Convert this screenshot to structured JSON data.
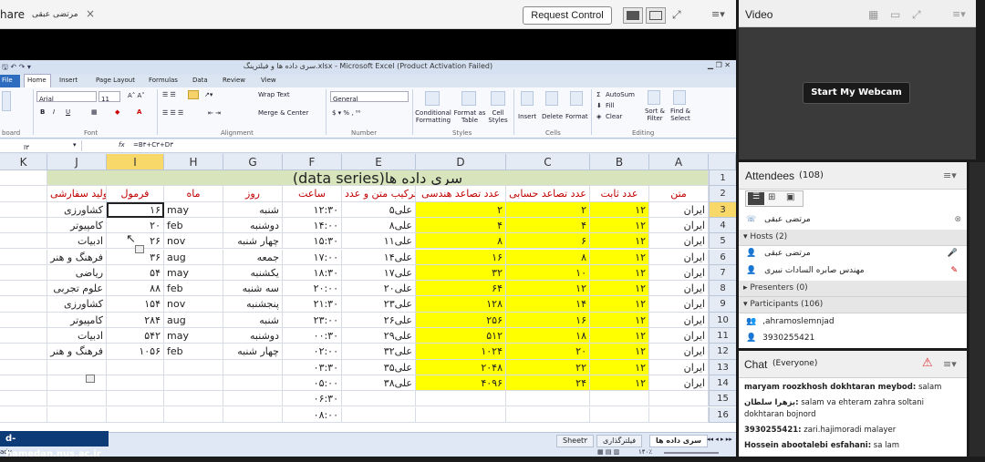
{
  "share": {
    "title": "hare",
    "presenter": "مرتضی عبقی",
    "close": "×",
    "request_control": "Request Control"
  },
  "excel": {
    "window_title": "سری داده ها و فیلترینگ.xlsx - Microsoft Excel (Product Activation Failed)",
    "ribbon_tabs": [
      "File",
      "Home",
      "Insert",
      "Page Layout",
      "Formulas",
      "Data",
      "Review",
      "View"
    ],
    "font_name": "Arial",
    "font_size": "11",
    "number_format": "General",
    "buttons": {
      "wrap_text": "Wrap Text",
      "merge_center": "Merge & Center",
      "cond_format": "Conditional Formatting",
      "format_table": "Format as Table",
      "cell_styles": "Cell Styles",
      "insert": "Insert",
      "delete": "Delete",
      "format": "Format",
      "autosum": "AutoSum",
      "fill": "Fill",
      "clear": "Clear",
      "sort_filter": "Sort & Filter",
      "find_select": "Find & Select"
    },
    "groups": [
      "board",
      "Font",
      "Alignment",
      "Number",
      "Styles",
      "Cells",
      "Editing"
    ],
    "name_box": "I۳",
    "formula": "=B۳+C۳+D۳",
    "fx": "fx",
    "columns": [
      "K",
      "J",
      "I",
      "H",
      "G",
      "F",
      "E",
      "D",
      "C",
      "B",
      "A"
    ],
    "row_numbers": [
      "1",
      "2",
      "3",
      "4",
      "5",
      "6",
      "7",
      "8",
      "9",
      "10",
      "11",
      "12",
      "13",
      "14",
      "15",
      "16"
    ],
    "sheet_title": "سری داده ها(data series)",
    "headers": {
      "A": "متن",
      "B": "عدد ثابت",
      "C": "عدد تصاعد حسابی",
      "D": "عدد تصاعد هندسی",
      "E": "ترکیب متن و عدد",
      "F": "ساعت",
      "G": "روز",
      "H": "ماه",
      "I": "فرمول",
      "J": "تولید سفارشی"
    },
    "rows": [
      {
        "A": "ایران",
        "B": "۱۲",
        "C": "۲",
        "D": "۲",
        "E": "علی۵",
        "F": "۱۲:۳۰",
        "G": "شنبه",
        "H": "may",
        "I": "۱۶",
        "J": "کشاورزی"
      },
      {
        "A": "ایران",
        "B": "۱۲",
        "C": "۴",
        "D": "۴",
        "E": "علی۸",
        "F": "۱۴:۰۰",
        "G": "دوشنبه",
        "H": "feb",
        "I": "۲۰",
        "J": "کامپیوتر"
      },
      {
        "A": "ایران",
        "B": "۱۲",
        "C": "۶",
        "D": "۸",
        "E": "علی۱۱",
        "F": "۱۵:۳۰",
        "G": "چهار شنبه",
        "H": "nov",
        "I": "۲۶",
        "J": "ادبیات"
      },
      {
        "A": "ایران",
        "B": "۱۲",
        "C": "۸",
        "D": "۱۶",
        "E": "علی۱۴",
        "F": "۱۷:۰۰",
        "G": "جمعه",
        "H": "aug",
        "I": "۳۶",
        "J": "فرهنگ و هنر"
      },
      {
        "A": "ایران",
        "B": "۱۲",
        "C": "۱۰",
        "D": "۳۲",
        "E": "علی۱۷",
        "F": "۱۸:۳۰",
        "G": "یکشنبه",
        "H": "may",
        "I": "۵۴",
        "J": "ریاضی"
      },
      {
        "A": "ایران",
        "B": "۱۲",
        "C": "۱۲",
        "D": "۶۴",
        "E": "علی۲۰",
        "F": "۲۰:۰۰",
        "G": "سه شنبه",
        "H": "feb",
        "I": "۸۸",
        "J": "علوم تجربی"
      },
      {
        "A": "ایران",
        "B": "۱۲",
        "C": "۱۴",
        "D": "۱۲۸",
        "E": "علی۲۳",
        "F": "۲۱:۳۰",
        "G": "پنجشنبه",
        "H": "nov",
        "I": "۱۵۴",
        "J": "کشاورزی"
      },
      {
        "A": "ایران",
        "B": "۱۲",
        "C": "۱۶",
        "D": "۲۵۶",
        "E": "علی۲۶",
        "F": "۲۳:۰۰",
        "G": "شنبه",
        "H": "aug",
        "I": "۲۸۴",
        "J": "کامپیوتر"
      },
      {
        "A": "ایران",
        "B": "۱۲",
        "C": "۱۸",
        "D": "۵۱۲",
        "E": "علی۲۹",
        "F": "۰۰:۳۰",
        "G": "دوشنبه",
        "H": "may",
        "I": "۵۴۲",
        "J": "ادبیات"
      },
      {
        "A": "ایران",
        "B": "۱۲",
        "C": "۲۰",
        "D": "۱۰۲۴",
        "E": "علی۳۲",
        "F": "۰۲:۰۰",
        "G": "چهار شنبه",
        "H": "feb",
        "I": "۱۰۵۶",
        "J": "فرهنگ و هنر"
      },
      {
        "A": "ایران",
        "B": "۱۲",
        "C": "۲۲",
        "D": "۲۰۴۸",
        "E": "علی۳۵",
        "F": "۰۳:۳۰",
        "G": "",
        "H": "",
        "I": "",
        "J": ""
      },
      {
        "A": "ایران",
        "B": "۱۲",
        "C": "۲۴",
        "D": "۴۰۹۶",
        "E": "علی۳۸",
        "F": "۰۵:۰۰",
        "G": "",
        "H": "",
        "I": "",
        "J": ""
      },
      {
        "A": "",
        "B": "",
        "C": "",
        "D": "",
        "E": "",
        "F": "۰۶:۳۰",
        "G": "",
        "H": "",
        "I": "",
        "J": ""
      },
      {
        "A": "",
        "B": "",
        "C": "",
        "D": "",
        "E": "",
        "F": "۰۸:۰۰",
        "G": "",
        "H": "",
        "I": "",
        "J": ""
      }
    ],
    "sheet_tabs": [
      "Sheet۲",
      "فیلترگذاری",
      "سری داده ها"
    ],
    "zoom": "۱۴۰٪",
    "status": "ady"
  },
  "watermark": "d-hamedan.nus.ac.ir",
  "video": {
    "title": "Video",
    "start_webcam": "Start My Webcam"
  },
  "attendees": {
    "title": "Attendees",
    "count": "(108)",
    "current_user": "مرتضی عبقی",
    "hosts_label": "Hosts (2)",
    "hosts": [
      "مرتضی عبقی",
      "مهندس صابره السادات نبیری"
    ],
    "presenters_label": "Presenters (0)",
    "participants_label": "Participants (106)",
    "participants": [
      ",ahramoslemnjad",
      "3930255421"
    ]
  },
  "chat": {
    "title": "Chat",
    "scope": "(Everyone)",
    "messages": [
      {
        "sender": "maryam roozkhosh dokhtaran meybod:",
        "text": " salam"
      },
      {
        "sender": "بزهرا سلطان:",
        "text": " salam va ehteram zahra soltani dokhtaran bojnord"
      },
      {
        "sender": "3930255421:",
        "text": " zari.hajimoradi  malayer"
      },
      {
        "sender": "Hossein abootalebi esfahani:",
        "text": " sa lam"
      }
    ]
  },
  "colors": {
    "highlight": "#ffff00",
    "header_red": "#c00000",
    "title_band": "#d8e4bc"
  }
}
